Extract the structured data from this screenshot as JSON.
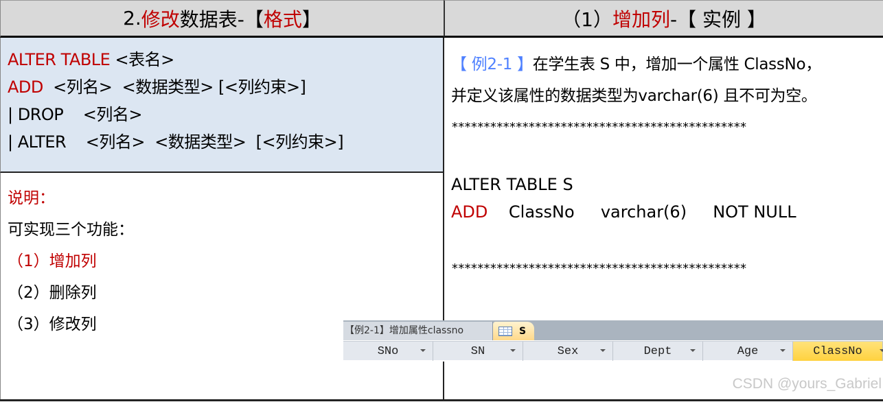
{
  "left_header": {
    "prefix": "2.",
    "highlight1": "修改",
    "middle": "数据表-【 ",
    "highlight2": "格式",
    "suffix": " 】"
  },
  "right_header": {
    "prefix": "（1）",
    "highlight": "增加列",
    "suffix": " -【 实例 】"
  },
  "syntax": {
    "line1_keyword": "ALTER TABLE",
    "line1_rest": " <表名>",
    "line2_keyword": "ADD",
    "line2_rest": "  <列名>  <数据类型> [<列约束>]",
    "line3": "| DROP    <列名>",
    "line4": "| ALTER    <列名>  <数据类型>  [<列约束>]"
  },
  "notes": {
    "title": "说明：",
    "intro": "可实现三个功能：",
    "items": [
      "（1）增加列",
      "（2）删除列",
      "（3）修改列"
    ]
  },
  "example": {
    "label": "【 例2-1 】",
    "line1": "在学生表 S 中，增加一个属性 ClassNo，",
    "line2": "并定义该属性的数据类型为varchar(6) 且不可为空。",
    "stars": "**********************************************",
    "code_line1": "ALTER TABLE S",
    "code_line2_keyword": "ADD",
    "code_line2_rest": "    ClassNo     varchar(6)     NOT NULL"
  },
  "access": {
    "query_tab": "【例2-1】增加属性classno",
    "table_tab": "S",
    "columns": [
      "SNo",
      "SN",
      "Sex",
      "Dept",
      "Age",
      "ClassNo"
    ],
    "selected_column": "ClassNo"
  },
  "watermark": "CSDN @yours_Gabriel"
}
